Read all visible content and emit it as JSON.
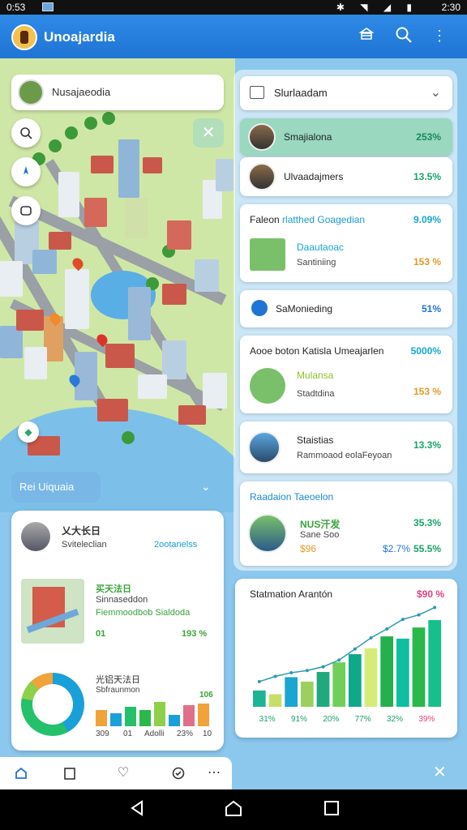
{
  "status_bar": {
    "time_left": "0:53",
    "icons": "✱ ◥ ◢ ▮",
    "time_right": "2:30"
  },
  "app_bar": {
    "title": "Unoajardia",
    "icons": [
      "bank-icon",
      "search-icon",
      "more-vert-icon"
    ]
  },
  "map": {
    "search_label": "Nusajaeodia",
    "section_chip": "Rei Uiquaia"
  },
  "left_card": {
    "item1_title": "乂大长日",
    "item1_sub": "Sviteleclian",
    "item1_value": "2ootanelss",
    "item2_title": "买天法日",
    "item2_line1": "Sinnaseddon",
    "item2_line2": "Fiemmoodbob Sialdoda",
    "item2_left": "01",
    "item2_right": "193 %",
    "item3_title": "光铝天法日",
    "item3_sub": "Sbfraunmon",
    "item3_value": "106",
    "bar_labels": [
      "309",
      "01",
      "Adolli",
      "23%",
      "10"
    ]
  },
  "right_panel": {
    "dropdown_label": "Slurlaadam",
    "rows": [
      {
        "name": "Smajialona",
        "value": "253%"
      },
      {
        "name": "Ulvaadajmers",
        "value": "13.5%"
      }
    ],
    "block1": {
      "heading": "Faleon ",
      "heading_hl": "rlatthed Goagedian",
      "heading_value": "9.09%",
      "title": "Daautaoac",
      "sub": "Santiniing",
      "value": "153 %"
    },
    "block2": {
      "label": "SaMonieding",
      "value": "51%"
    },
    "block3": {
      "heading": "Aooe boton Katisla Umeajarlen",
      "heading_value": "5000%",
      "title": "Mulansa",
      "sub": "Stadtdina",
      "value": "153 %"
    },
    "block4": {
      "title": "Staistias",
      "sub": "Rammoaod eolaFeyoan",
      "value": "13.3%"
    },
    "block5": {
      "heading": "Raadaion Taeoelon",
      "title": "NUS汗发",
      "sub": "Sane Soo",
      "left": "$96",
      "mid": "$2.7%",
      "value": "35.3%",
      "value2": "55.5%"
    }
  },
  "chart_data": {
    "type": "bar",
    "title": "Statmation Arantón",
    "title_value": "$90 %",
    "categories": [
      "31%",
      "",
      "91%",
      "",
      "20%",
      "",
      "77%",
      "",
      "32%",
      "",
      "39%",
      ""
    ],
    "values": [
      22,
      17,
      40,
      34,
      47,
      60,
      71,
      79,
      95,
      92,
      107,
      117
    ],
    "colors": [
      "#1fb396",
      "#c5e06a",
      "#1aa6d0",
      "#9bd05e",
      "#1fa97c",
      "#6fcf5a",
      "#0fa88a",
      "#d6ec7a",
      "#24b04e",
      "#0fbe9e",
      "#2ab84a",
      "#16c08a"
    ],
    "line": [
      34,
      41,
      46,
      49,
      54,
      63,
      78,
      93,
      105,
      118,
      124,
      134
    ],
    "ylim": [
      0,
      140
    ]
  },
  "bottom_nav": {
    "items": [
      "home-icon",
      "bookmark-icon",
      "heart-icon",
      "map-icon",
      "more-icon"
    ]
  }
}
